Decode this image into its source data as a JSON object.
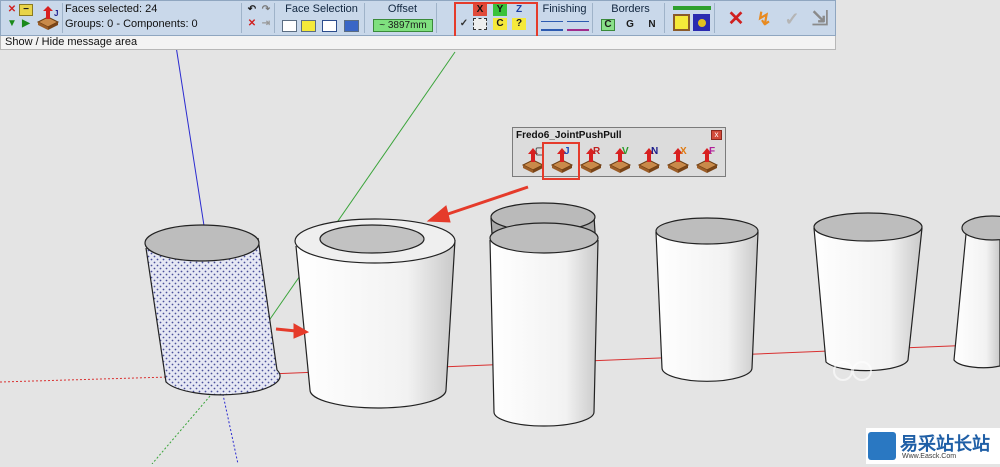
{
  "toolbar": {
    "faces_selected": "Faces selected: 24",
    "groups_components": "Groups: 0 - Components: 0",
    "face_selection_label": "Face Selection",
    "offset_label": "Offset",
    "offset_value": "~ 3897mm",
    "axis_x": "X",
    "axis_y": "Y",
    "axis_z": "Z",
    "axis_c": "C",
    "axis_help": "?",
    "finishing_label": "Finishing",
    "borders_label": "Borders",
    "border_c": "C",
    "border_g": "G",
    "border_n": "N"
  },
  "status": {
    "message": "Show / Hide message area"
  },
  "palette": {
    "title": "Fredo6_JointPushPull",
    "close": "x",
    "tools": [
      {
        "name": "vector-pushpull",
        "letter": "▢"
      },
      {
        "name": "joint-pushpull",
        "letter": "J"
      },
      {
        "name": "round-pushpull",
        "letter": "R"
      },
      {
        "name": "vector-pushpull-v",
        "letter": "V"
      },
      {
        "name": "normal-pushpull",
        "letter": "N"
      },
      {
        "name": "extrude-pushpull",
        "letter": "X"
      },
      {
        "name": "follow-pushpull",
        "letter": "F"
      }
    ]
  },
  "watermark": {
    "name": "易采站长站",
    "sub": "Www.Easck.Com"
  },
  "colors": {
    "accent_red": "#e53b2b",
    "toolbar_bg": "#c9d8ea",
    "axis_red": "#d93030",
    "axis_green": "#3aa43a",
    "axis_blue": "#2b2bd0"
  }
}
